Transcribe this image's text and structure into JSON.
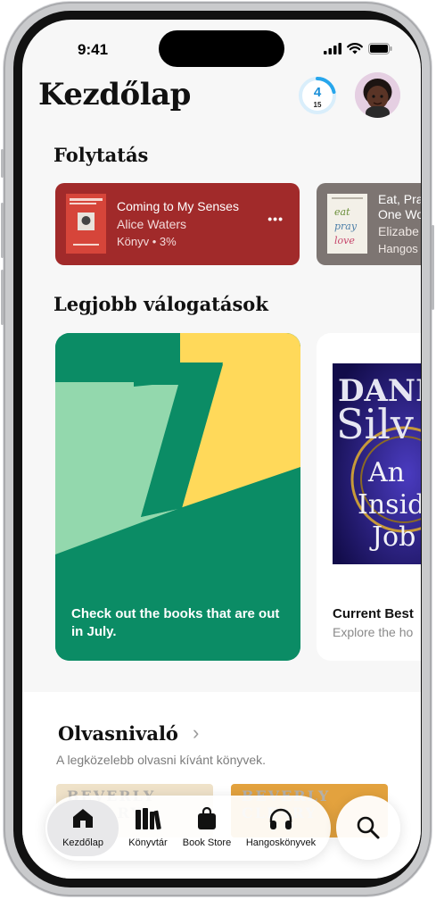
{
  "status_bar": {
    "time": "9:41"
  },
  "header": {
    "title": "Kezdőlap",
    "reading_goal": {
      "current": "4",
      "target": "15"
    }
  },
  "continue": {
    "title": "Folytatás",
    "items": [
      {
        "title": "Coming to My Senses",
        "author": "Alice Waters",
        "meta": "Könyv • 3%",
        "more": "•••",
        "color": "#a12a2a"
      },
      {
        "title": "Eat, Pray, Love: One Woman's Search",
        "title_lines": [
          "Eat, Pra",
          "One Wo"
        ],
        "author": "Elizabeth Gilbert",
        "author_short": "Elizabe",
        "meta": "Hangos",
        "color": "#7d7572"
      }
    ]
  },
  "top_picks": {
    "title": "Legjobb válogatások",
    "cards": [
      {
        "text": "Check out the books that are out in July.",
        "color": "#0b8c65",
        "accent": "#ffd95a",
        "light": "#93d8ad"
      },
      {
        "title": "Current Best",
        "subtitle": "Explore the ho",
        "book_lines": [
          "DANI",
          "Silv",
          "An",
          "Insid",
          "Job"
        ]
      }
    ]
  },
  "want_to_read": {
    "title": "Olvasnivaló",
    "chevron": "›",
    "subtitle": "A legközelebb olvasni kívánt könyvek.",
    "books": [
      {
        "label": "BEVERLY CLEARY"
      },
      {
        "label": "BEVERLY CLEARY"
      }
    ]
  },
  "tab_bar": {
    "tabs": [
      {
        "label": "Kezdőlap",
        "icon": "home-icon",
        "active": true
      },
      {
        "label": "Könyvtár",
        "icon": "library-icon",
        "active": false
      },
      {
        "label": "Book Store",
        "icon": "bag-icon",
        "active": false
      },
      {
        "label": "Hangoskönyvek",
        "icon": "headphones-icon",
        "active": false
      }
    ],
    "search_icon": "magnifier-icon"
  }
}
